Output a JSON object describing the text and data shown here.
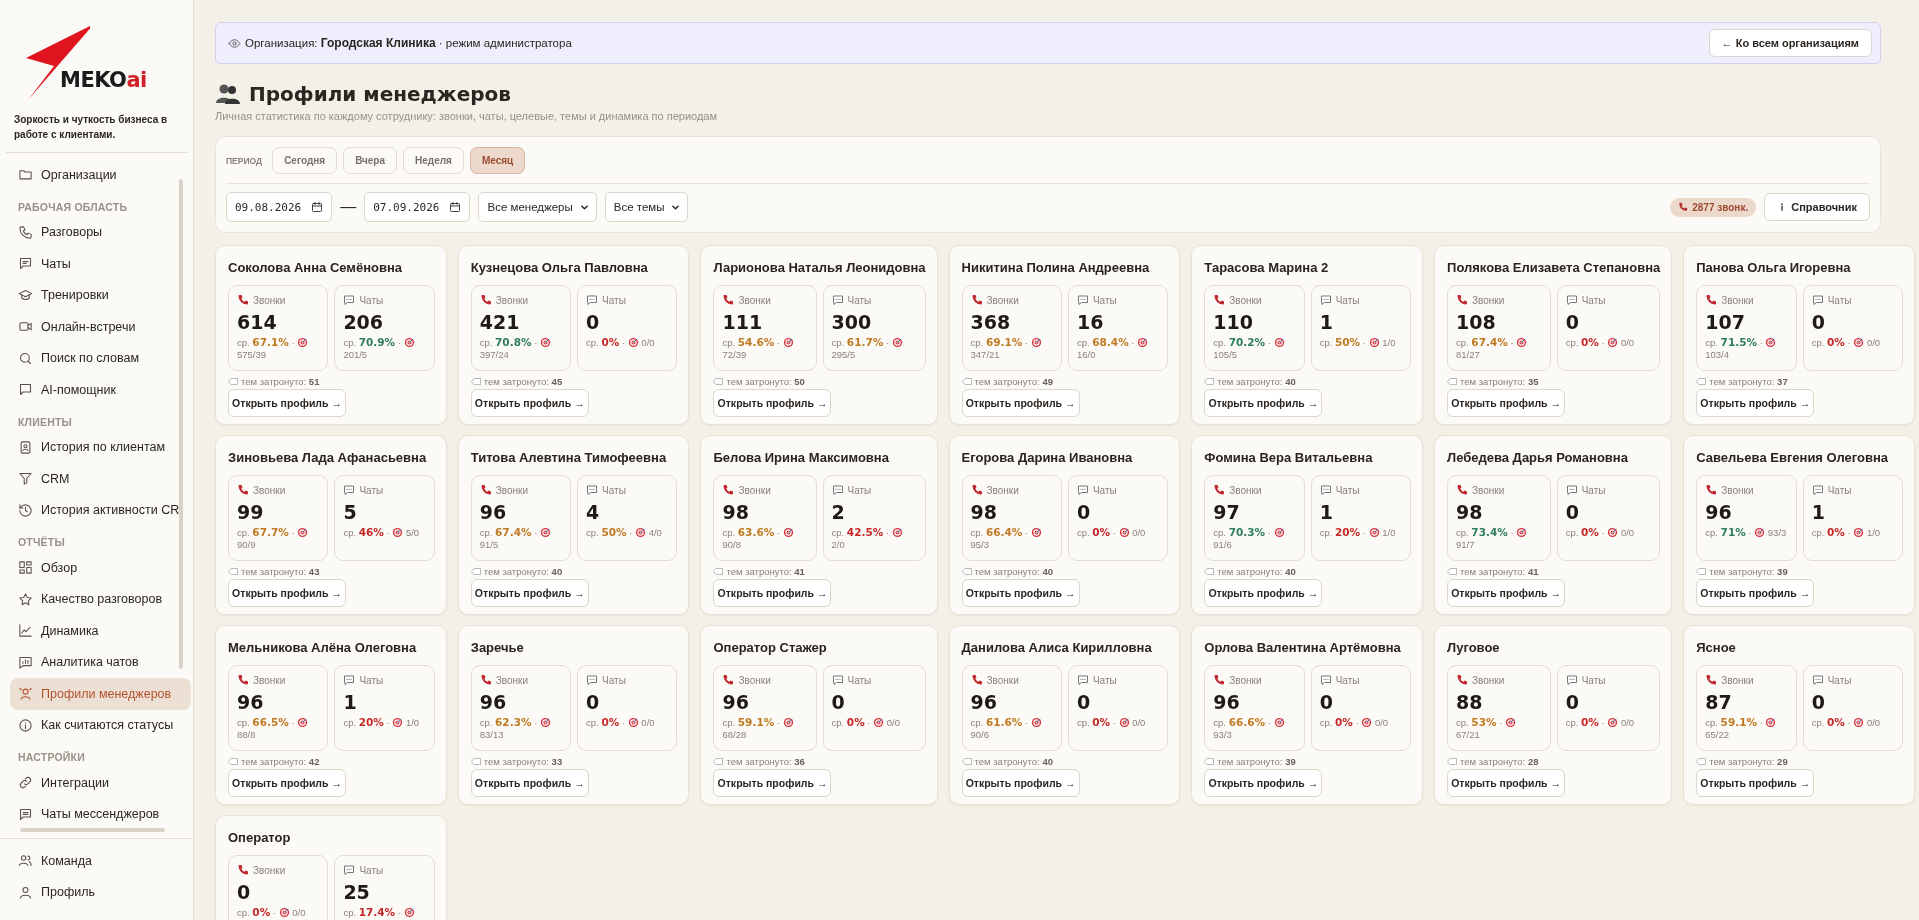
{
  "sidebar": {
    "logo": {
      "text": "MEKO",
      "accent": "ai"
    },
    "tagline": "Зоркость и чуткость бизнеса в работе с клиентами.",
    "top_items": [
      {
        "label": "Организации",
        "selected": false
      }
    ],
    "sections": [
      {
        "title": "РАБОЧАЯ ОБЛАСТЬ",
        "items": [
          {
            "label": "Разговоры",
            "selected": false
          },
          {
            "label": "Чаты",
            "selected": false
          },
          {
            "label": "Тренировки",
            "selected": false
          },
          {
            "label": "Онлайн-встречи",
            "selected": false
          },
          {
            "label": "Поиск по словам",
            "selected": false
          },
          {
            "label": "AI-помощник",
            "selected": false
          }
        ]
      },
      {
        "title": "КЛИЕНТЫ",
        "items": [
          {
            "label": "История по клиентам",
            "selected": false
          },
          {
            "label": "CRM",
            "selected": false
          },
          {
            "label": "История активности CR",
            "selected": false
          }
        ]
      },
      {
        "title": "ОТЧЁТЫ",
        "items": [
          {
            "label": "Обзор",
            "selected": false
          },
          {
            "label": "Качество разговоров",
            "selected": false
          },
          {
            "label": "Динамика",
            "selected": false
          },
          {
            "label": "Аналитика чатов",
            "selected": false
          },
          {
            "label": "Профили менеджеров",
            "selected": true
          },
          {
            "label": "Как считаются статусы",
            "selected": false
          }
        ]
      },
      {
        "title": "НАСТРОЙКИ",
        "items": [
          {
            "label": "Интеграции",
            "selected": false
          },
          {
            "label": "Чаты мессенджеров",
            "selected": false
          }
        ]
      }
    ],
    "bottom_items": [
      {
        "label": "Команда",
        "selected": false
      },
      {
        "label": "Профиль",
        "selected": false
      }
    ]
  },
  "banner": {
    "prefix": "Организация:",
    "organization": "Городская Клиника",
    "mode": "· режим администратора",
    "button": "← Ко всем организациям"
  },
  "page": {
    "title": "Профили менеджеров",
    "subtitle": "Личная статистика по каждому сотруднику: звонки, чаты, целевые, темы и динамика по периодам"
  },
  "filters": {
    "period_label": "ПЕРИОД",
    "periods": [
      {
        "label": "Сегодня",
        "selected": false
      },
      {
        "label": "Вчера",
        "selected": false
      },
      {
        "label": "Неделя",
        "selected": false
      },
      {
        "label": "Месяц",
        "selected": true
      }
    ],
    "date_from": "09.08.2026",
    "dash": "—",
    "date_to": "07.09.2026",
    "manager_select": "Все менеджеры",
    "topic_select": "Все темы",
    "calls_badge": "2877 звонк.",
    "help_button": "Справочник"
  },
  "managers": [
    {
      "name": "Соколова Анна Семёновна",
      "stats": [
        {
          "kind": "calls",
          "label": "Звонки",
          "value": "614",
          "avg": "ср.",
          "rate": "67.1%",
          "color": "#c07a22",
          "sep": "·",
          "ratio": "575/39"
        },
        {
          "kind": "chats",
          "label": "Чаты",
          "value": "206",
          "avg": "ср.",
          "rate": "70.9%",
          "color": "#2e7d5b",
          "sep": "·",
          "ratio": "201/5"
        }
      ],
      "topics_label": "тем затронуто:",
      "topics": "51",
      "button": "Открыть профиль →"
    },
    {
      "name": "Кузнецова Ольга Павловна",
      "stats": [
        {
          "kind": "calls",
          "label": "Звонки",
          "value": "421",
          "avg": "ср.",
          "rate": "70.8%",
          "color": "#2e7d5b",
          "sep": "·",
          "ratio": "397/24"
        },
        {
          "kind": "chats",
          "label": "Чаты",
          "value": "0",
          "avg": "ср.",
          "rate": "0%",
          "color": "#c62828",
          "sep": "·",
          "ratio": "0/0"
        }
      ],
      "topics_label": "тем затронуто:",
      "topics": "45",
      "button": "Открыть профиль →"
    },
    {
      "name": "Ларионова Наталья Леонидовна",
      "stats": [
        {
          "kind": "calls",
          "label": "Звонки",
          "value": "111",
          "avg": "ср.",
          "rate": "54.6%",
          "color": "#c07a22",
          "sep": "·",
          "ratio": "72/39"
        },
        {
          "kind": "chats",
          "label": "Чаты",
          "value": "300",
          "avg": "ср.",
          "rate": "61.7%",
          "color": "#c07a22",
          "sep": "·",
          "ratio": "295/5"
        }
      ],
      "topics_label": "тем затронуто:",
      "topics": "50",
      "button": "Открыть профиль →"
    },
    {
      "name": "Никитина Полина Андреевна",
      "stats": [
        {
          "kind": "calls",
          "label": "Звонки",
          "value": "368",
          "avg": "ср.",
          "rate": "69.1%",
          "color": "#c07a22",
          "sep": "·",
          "ratio": "347/21"
        },
        {
          "kind": "chats",
          "label": "Чаты",
          "value": "16",
          "avg": "ср.",
          "rate": "68.4%",
          "color": "#c07a22",
          "sep": "·",
          "ratio": "16/0"
        }
      ],
      "topics_label": "тем затронуто:",
      "topics": "49",
      "button": "Открыть профиль →"
    },
    {
      "name": "Тарасова Марина 2",
      "stats": [
        {
          "kind": "calls",
          "label": "Звонки",
          "value": "110",
          "avg": "ср.",
          "rate": "70.2%",
          "color": "#2e7d5b",
          "sep": "·",
          "ratio": "105/5"
        },
        {
          "kind": "chats",
          "label": "Чаты",
          "value": "1",
          "avg": "ср.",
          "rate": "50%",
          "color": "#c07a22",
          "sep": "·",
          "ratio": "1/0"
        }
      ],
      "topics_label": "тем затронуто:",
      "topics": "40",
      "button": "Открыть профиль →"
    },
    {
      "name": "Полякова Елизавета Степановна",
      "stats": [
        {
          "kind": "calls",
          "label": "Звонки",
          "value": "108",
          "avg": "ср.",
          "rate": "67.4%",
          "color": "#c07a22",
          "sep": "·",
          "ratio": "81/27"
        },
        {
          "kind": "chats",
          "label": "Чаты",
          "value": "0",
          "avg": "ср.",
          "rate": "0%",
          "color": "#c62828",
          "sep": "·",
          "ratio": "0/0"
        }
      ],
      "topics_label": "тем затронуто:",
      "topics": "35",
      "button": "Открыть профиль →"
    },
    {
      "name": "Панова Ольга Игоревна",
      "stats": [
        {
          "kind": "calls",
          "label": "Звонки",
          "value": "107",
          "avg": "ср.",
          "rate": "71.5%",
          "color": "#2e7d5b",
          "sep": "·",
          "ratio": "103/4"
        },
        {
          "kind": "chats",
          "label": "Чаты",
          "value": "0",
          "avg": "ср.",
          "rate": "0%",
          "color": "#c62828",
          "sep": "·",
          "ratio": "0/0"
        }
      ],
      "topics_label": "тем затронуто:",
      "topics": "37",
      "button": "Открыть профиль →"
    },
    {
      "name": "Зиновьева Лада Афанасьевна",
      "stats": [
        {
          "kind": "calls",
          "label": "Звонки",
          "value": "99",
          "avg": "ср.",
          "rate": "67.7%",
          "color": "#c07a22",
          "sep": "·",
          "ratio": "90/9"
        },
        {
          "kind": "chats",
          "label": "Чаты",
          "value": "5",
          "avg": "ср.",
          "rate": "46%",
          "color": "#c62828",
          "sep": "·",
          "ratio": "5/0"
        }
      ],
      "topics_label": "тем затронуто:",
      "topics": "43",
      "button": "Открыть профиль →"
    },
    {
      "name": "Титова Алевтина Тимофеевна",
      "stats": [
        {
          "kind": "calls",
          "label": "Звонки",
          "value": "96",
          "avg": "ср.",
          "rate": "67.4%",
          "color": "#c07a22",
          "sep": "·",
          "ratio": "91/5"
        },
        {
          "kind": "chats",
          "label": "Чаты",
          "value": "4",
          "avg": "ср.",
          "rate": "50%",
          "color": "#c07a22",
          "sep": "·",
          "ratio": "4/0"
        }
      ],
      "topics_label": "тем затронуто:",
      "topics": "40",
      "button": "Открыть профиль →"
    },
    {
      "name": "Белова Ирина Максимовна",
      "stats": [
        {
          "kind": "calls",
          "label": "Звонки",
          "value": "98",
          "avg": "ср.",
          "rate": "63.6%",
          "color": "#c07a22",
          "sep": "·",
          "ratio": "90/8"
        },
        {
          "kind": "chats",
          "label": "Чаты",
          "value": "2",
          "avg": "ср.",
          "rate": "42.5%",
          "color": "#c62828",
          "sep": "·",
          "ratio": "2/0"
        }
      ],
      "topics_label": "тем затронуто:",
      "topics": "41",
      "button": "Открыть профиль →"
    },
    {
      "name": "Егорова Дарина Ивановна",
      "stats": [
        {
          "kind": "calls",
          "label": "Звонки",
          "value": "98",
          "avg": "ср.",
          "rate": "66.4%",
          "color": "#c07a22",
          "sep": "·",
          "ratio": "95/3"
        },
        {
          "kind": "chats",
          "label": "Чаты",
          "value": "0",
          "avg": "ср.",
          "rate": "0%",
          "color": "#c62828",
          "sep": "·",
          "ratio": "0/0"
        }
      ],
      "topics_label": "тем затронуто:",
      "topics": "40",
      "button": "Открыть профиль →"
    },
    {
      "name": "Фомина Вера Витальевна",
      "stats": [
        {
          "kind": "calls",
          "label": "Звонки",
          "value": "97",
          "avg": "ср.",
          "rate": "70.3%",
          "color": "#2e7d5b",
          "sep": "·",
          "ratio": "91/6"
        },
        {
          "kind": "chats",
          "label": "Чаты",
          "value": "1",
          "avg": "ср.",
          "rate": "20%",
          "color": "#c62828",
          "sep": "·",
          "ratio": "1/0"
        }
      ],
      "topics_label": "тем затронуто:",
      "topics": "40",
      "button": "Открыть профиль →"
    },
    {
      "name": "Лебедева Дарья Романовна",
      "stats": [
        {
          "kind": "calls",
          "label": "Звонки",
          "value": "98",
          "avg": "ср.",
          "rate": "73.4%",
          "color": "#2e7d5b",
          "sep": "·",
          "ratio": "91/7"
        },
        {
          "kind": "chats",
          "label": "Чаты",
          "value": "0",
          "avg": "ср.",
          "rate": "0%",
          "color": "#c62828",
          "sep": "·",
          "ratio": "0/0"
        }
      ],
      "topics_label": "тем затронуто:",
      "topics": "41",
      "button": "Открыть профиль →"
    },
    {
      "name": "Савельева Евгения Олеговна",
      "stats": [
        {
          "kind": "calls",
          "label": "Звонки",
          "value": "96",
          "avg": "ср.",
          "rate": "71%",
          "color": "#2e7d5b",
          "sep": "·",
          "ratio": "93/3"
        },
        {
          "kind": "chats",
          "label": "Чаты",
          "value": "1",
          "avg": "ср.",
          "rate": "0%",
          "color": "#c62828",
          "sep": "·",
          "ratio": "1/0"
        }
      ],
      "topics_label": "тем затронуто:",
      "topics": "39",
      "button": "Открыть профиль →"
    },
    {
      "name": "Мельникова Алёна Олеговна",
      "stats": [
        {
          "kind": "calls",
          "label": "Звонки",
          "value": "96",
          "avg": "ср.",
          "rate": "66.5%",
          "color": "#c07a22",
          "sep": "·",
          "ratio": "88/8"
        },
        {
          "kind": "chats",
          "label": "Чаты",
          "value": "1",
          "avg": "ср.",
          "rate": "20%",
          "color": "#c62828",
          "sep": "·",
          "ratio": "1/0"
        }
      ],
      "topics_label": "тем затронуто:",
      "topics": "42",
      "button": "Открыть профиль →"
    },
    {
      "name": "Заречье",
      "stats": [
        {
          "kind": "calls",
          "label": "Звонки",
          "value": "96",
          "avg": "ср.",
          "rate": "62.3%",
          "color": "#c07a22",
          "sep": "·",
          "ratio": "83/13"
        },
        {
          "kind": "chats",
          "label": "Чаты",
          "value": "0",
          "avg": "ср.",
          "rate": "0%",
          "color": "#c62828",
          "sep": "·",
          "ratio": "0/0"
        }
      ],
      "topics_label": "тем затронуто:",
      "topics": "33",
      "button": "Открыть профиль →"
    },
    {
      "name": "Оператор Стажер",
      "stats": [
        {
          "kind": "calls",
          "label": "Звонки",
          "value": "96",
          "avg": "ср.",
          "rate": "59.1%",
          "color": "#c07a22",
          "sep": "·",
          "ratio": "68/28"
        },
        {
          "kind": "chats",
          "label": "Чаты",
          "value": "0",
          "avg": "ср.",
          "rate": "0%",
          "color": "#c62828",
          "sep": "·",
          "ratio": "0/0"
        }
      ],
      "topics_label": "тем затронуто:",
      "topics": "36",
      "button": "Открыть профиль →"
    },
    {
      "name": "Данилова Алиса Кирилловна",
      "stats": [
        {
          "kind": "calls",
          "label": "Звонки",
          "value": "96",
          "avg": "ср.",
          "rate": "61.6%",
          "color": "#c07a22",
          "sep": "·",
          "ratio": "90/6"
        },
        {
          "kind": "chats",
          "label": "Чаты",
          "value": "0",
          "avg": "ср.",
          "rate": "0%",
          "color": "#c62828",
          "sep": "·",
          "ratio": "0/0"
        }
      ],
      "topics_label": "тем затронуто:",
      "topics": "40",
      "button": "Открыть профиль →"
    },
    {
      "name": "Орлова Валентина Артёмовна",
      "stats": [
        {
          "kind": "calls",
          "label": "Звонки",
          "value": "96",
          "avg": "ср.",
          "rate": "66.6%",
          "color": "#c07a22",
          "sep": "·",
          "ratio": "93/3"
        },
        {
          "kind": "chats",
          "label": "Чаты",
          "value": "0",
          "avg": "ср.",
          "rate": "0%",
          "color": "#c62828",
          "sep": "·",
          "ratio": "0/0"
        }
      ],
      "topics_label": "тем затронуто:",
      "topics": "39",
      "button": "Открыть профиль →"
    },
    {
      "name": "Луговое",
      "stats": [
        {
          "kind": "calls",
          "label": "Звонки",
          "value": "88",
          "avg": "ср.",
          "rate": "53%",
          "color": "#c07a22",
          "sep": "·",
          "ratio": "67/21"
        },
        {
          "kind": "chats",
          "label": "Чаты",
          "value": "0",
          "avg": "ср.",
          "rate": "0%",
          "color": "#c62828",
          "sep": "·",
          "ratio": "0/0"
        }
      ],
      "topics_label": "тем затронуто:",
      "topics": "28",
      "button": "Открыть профиль →"
    },
    {
      "name": "Ясное",
      "stats": [
        {
          "kind": "calls",
          "label": "Звонки",
          "value": "87",
          "avg": "ср.",
          "rate": "59.1%",
          "color": "#c07a22",
          "sep": "·",
          "ratio": "65/22"
        },
        {
          "kind": "chats",
          "label": "Чаты",
          "value": "0",
          "avg": "ср.",
          "rate": "0%",
          "color": "#c62828",
          "sep": "·",
          "ratio": "0/0"
        }
      ],
      "topics_label": "тем затронуто:",
      "topics": "29",
      "button": "Открыть профиль →"
    },
    {
      "name": "Оператор",
      "stats": [
        {
          "kind": "calls",
          "label": "Звонки",
          "value": "0",
          "avg": "ср.",
          "rate": "0%",
          "color": "#c62828",
          "sep": "·",
          "ratio": "0/0"
        },
        {
          "kind": "chats",
          "label": "Чаты",
          "value": "25",
          "avg": "ср.",
          "rate": "17.4%",
          "color": "#c62828",
          "sep": "·"
        }
      ]
    }
  ]
}
